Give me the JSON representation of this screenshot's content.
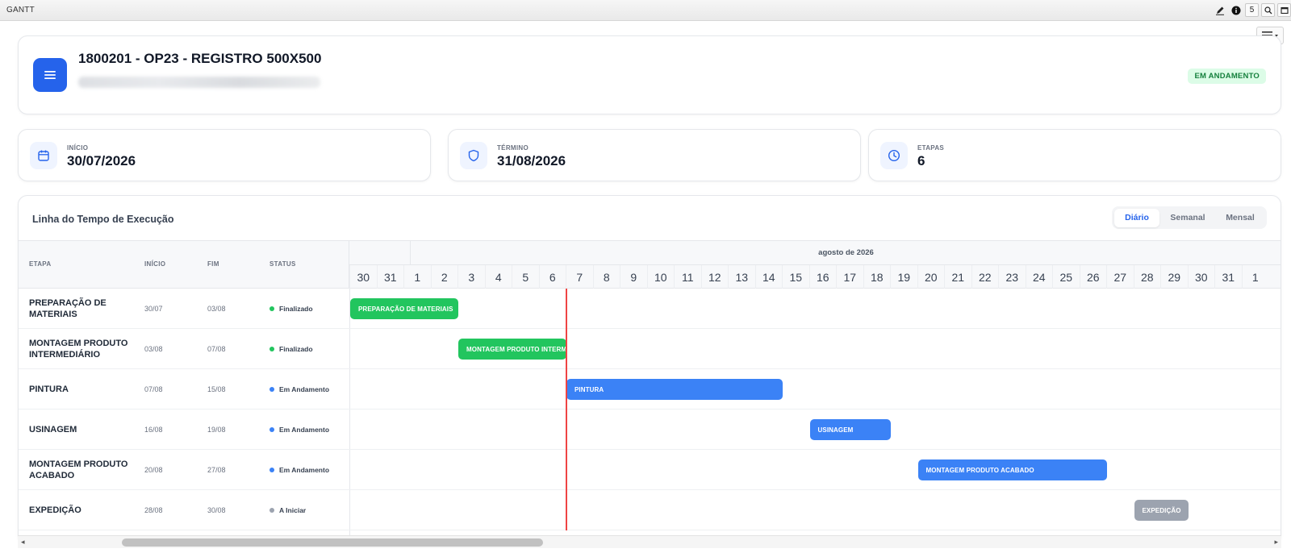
{
  "window": {
    "title": "GANTT",
    "tools": [
      {
        "name": "edit-icon",
        "label": ""
      },
      {
        "name": "info-icon",
        "label": ""
      },
      {
        "name": "five-button",
        "label": "5"
      },
      {
        "name": "search-icon",
        "label": ""
      },
      {
        "name": "window-icon",
        "label": ""
      }
    ]
  },
  "header": {
    "title": "1800201 - OP23 - REGISTRO 500X500",
    "status_badge": "EM ANDAMENTO",
    "icon": "list-icon"
  },
  "stats": [
    {
      "label": "INÍCIO",
      "value": "30/07/2026",
      "icon": "calendar-icon"
    },
    {
      "label": "TÉRMINO",
      "value": "31/08/2026",
      "icon": "shield-icon"
    },
    {
      "label": "ETAPAS",
      "value": "6",
      "icon": "clock-icon"
    }
  ],
  "timeline": {
    "title": "Linha do Tempo de Execução",
    "views": [
      "Diário",
      "Semanal",
      "Mensal"
    ],
    "active_view": "Diário",
    "columns": {
      "etapa": "ETAPA",
      "inicio": "INÍCIO",
      "fim": "FIM",
      "status": "STATUS"
    },
    "month_label": "agosto de 2026",
    "days": [
      "30",
      "31",
      "1",
      "2",
      "3",
      "4",
      "5",
      "6",
      "7",
      "8",
      "9",
      "10",
      "11",
      "12",
      "13",
      "14",
      "15",
      "16",
      "17",
      "18",
      "19",
      "20",
      "21",
      "22",
      "23",
      "24",
      "25",
      "26",
      "27",
      "28",
      "29",
      "30",
      "31",
      "1"
    ],
    "today_index": 8,
    "colors": {
      "finalizado": "#22c55e",
      "andamento": "#3b82f6",
      "iniciar": "#9ca3af",
      "today": "#ef4444",
      "accent": "#2563eb"
    },
    "tasks": [
      {
        "name": "PREPARAÇÃO DE MATERIAIS",
        "start": "30/07",
        "end": "03/08",
        "status": "Finalizado",
        "status_key": "finalizado",
        "bar_label": "PREPARAÇÃO DE MATERIAIS",
        "start_index": 0,
        "end_index": 4
      },
      {
        "name": "MONTAGEM PRODUTO INTERMEDIÁRIO",
        "start": "03/08",
        "end": "07/08",
        "status": "Finalizado",
        "status_key": "finalizado",
        "bar_label": "MONTAGEM PRODUTO INTERMEDIÁRIO",
        "start_index": 4,
        "end_index": 8
      },
      {
        "name": "PINTURA",
        "start": "07/08",
        "end": "15/08",
        "status": "Em Andamento",
        "status_key": "andamento",
        "bar_label": "PINTURA",
        "start_index": 8,
        "end_index": 16
      },
      {
        "name": "USINAGEM",
        "start": "16/08",
        "end": "19/08",
        "status": "Em Andamento",
        "status_key": "andamento",
        "bar_label": "USINAGEM",
        "start_index": 17,
        "end_index": 20
      },
      {
        "name": "MONTAGEM PRODUTO ACABADO",
        "start": "20/08",
        "end": "27/08",
        "status": "Em Andamento",
        "status_key": "andamento",
        "bar_label": "MONTAGEM PRODUTO ACABADO",
        "start_index": 21,
        "end_index": 28
      },
      {
        "name": "EXPEDIÇÃO",
        "start": "28/08",
        "end": "30/08",
        "status": "A Iniciar",
        "status_key": "iniciar",
        "bar_label": "EXPEDIÇÃO",
        "start_index": 29,
        "end_index": 31
      }
    ]
  }
}
